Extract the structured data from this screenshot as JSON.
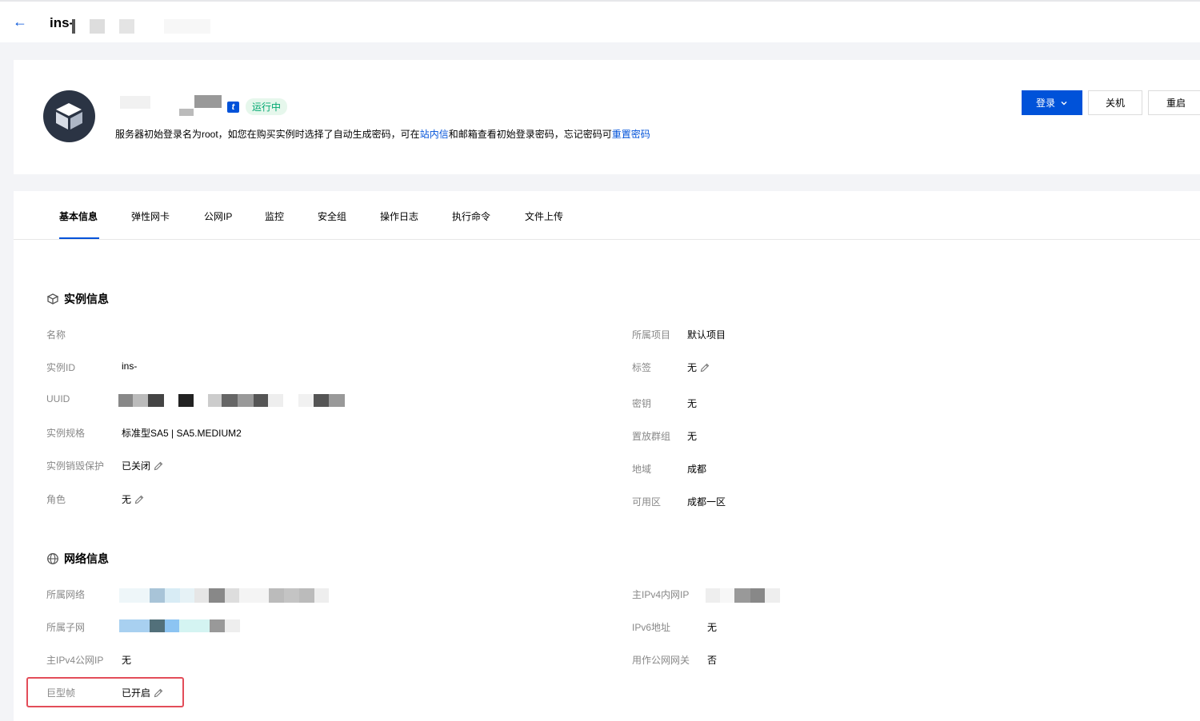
{
  "topbar": {
    "back_icon": "arrow-left-icon",
    "title": "ins-"
  },
  "header": {
    "status": "运行中",
    "notice_prefix": "服务器初始登录名为root，如您在购买实例时选择了自动生成密码，可在",
    "notice_link1": "站内信",
    "notice_middle": "和邮箱查看初始登录密码，忘记密码可",
    "notice_link2": "重置密码",
    "buttons": {
      "login": "登录",
      "shutdown": "关机",
      "restart": "重启"
    }
  },
  "tabs": [
    "基本信息",
    "弹性网卡",
    "公网IP",
    "监控",
    "安全组",
    "操作日志",
    "执行命令",
    "文件上传"
  ],
  "instance_section": {
    "title": "实例信息",
    "left": [
      {
        "label": "名称",
        "value": ""
      },
      {
        "label": "实例ID",
        "value": "ins-"
      },
      {
        "label": "UUID",
        "value": ""
      },
      {
        "label": "实例规格",
        "value": "标准型SA5 | SA5.MEDIUM2"
      },
      {
        "label": "实例销毁保护",
        "value": "已关闭"
      },
      {
        "label": "角色",
        "value": "无"
      }
    ],
    "right": [
      {
        "label": "所属项目",
        "value": "默认项目"
      },
      {
        "label": "标签",
        "value": "无"
      },
      {
        "label": "密钥",
        "value": "无"
      },
      {
        "label": "置放群组",
        "value": "无"
      },
      {
        "label": "地域",
        "value": "成都"
      },
      {
        "label": "可用区",
        "value": "成都一区"
      }
    ]
  },
  "network_section": {
    "title": "网络信息",
    "left": [
      {
        "label": "所属网络",
        "value": ""
      },
      {
        "label": "所属子网",
        "value": ""
      },
      {
        "label": "主IPv4公网IP",
        "value": "无"
      },
      {
        "label": "巨型帧",
        "value": "已开启"
      }
    ],
    "right": [
      {
        "label": "主IPv4内网IP",
        "value": ""
      },
      {
        "label": "IPv6地址",
        "value": "无"
      },
      {
        "label": "用作公网网关",
        "value": "否"
      }
    ]
  },
  "colors": {
    "primary": "#0052d9",
    "running": "#00a870",
    "highlight": "#e34d59"
  }
}
